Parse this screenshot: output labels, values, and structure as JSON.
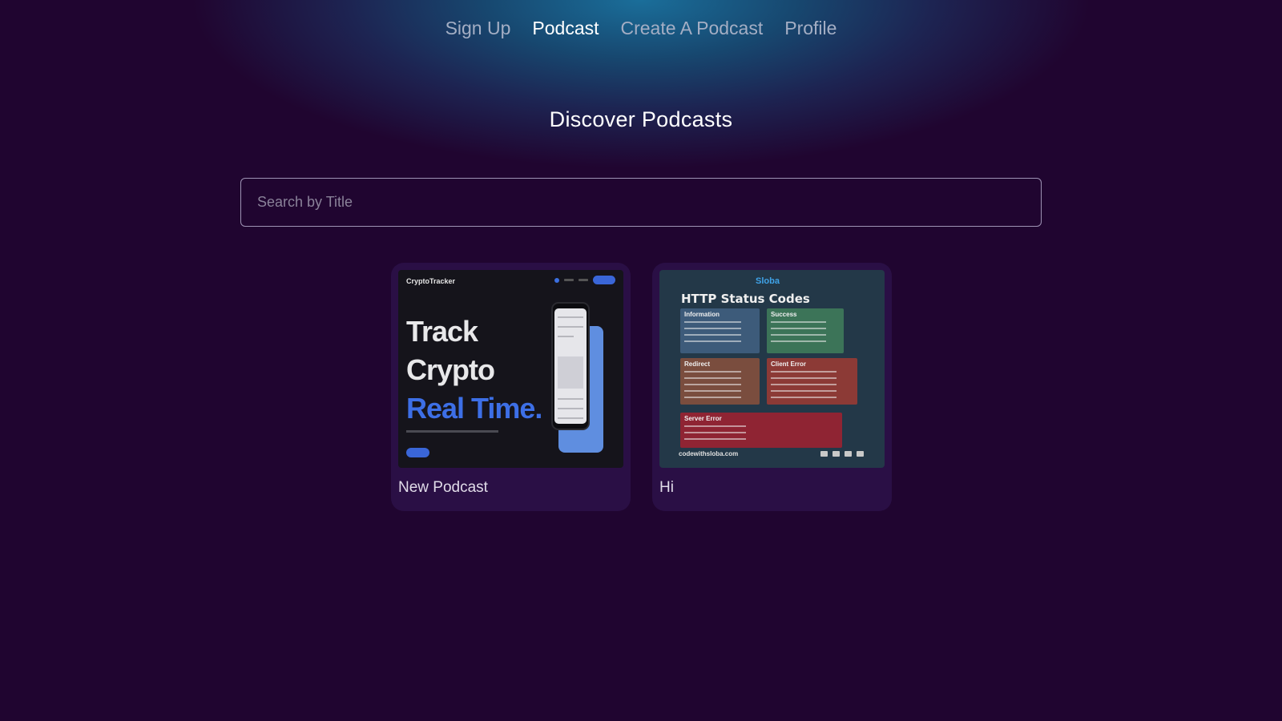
{
  "nav": {
    "items": [
      {
        "label": "Sign Up",
        "active": false
      },
      {
        "label": "Podcast",
        "active": true
      },
      {
        "label": "Create A Podcast",
        "active": false
      },
      {
        "label": "Profile",
        "active": false
      }
    ]
  },
  "page": {
    "title": "Discover Podcasts"
  },
  "search": {
    "placeholder": "Search by Title",
    "value": ""
  },
  "podcasts": [
    {
      "title": "New Podcast",
      "thumbnail": {
        "brand": "CryptoTracker",
        "headline": [
          "Track",
          "Crypto",
          "Real Time."
        ]
      }
    },
    {
      "title": "Hi",
      "thumbnail": {
        "logo": "Sloba",
        "heading": "HTTP Status Codes",
        "sections": [
          "Information",
          "Success",
          "Redirect",
          "Client Error",
          "Server Error"
        ],
        "footer": "codewithsloba.com"
      }
    }
  ],
  "colors": {
    "background": "#200530",
    "card": "#2a0f45",
    "accent_glow": "#1a6e9a",
    "nav_inactive": "#a4aec4",
    "nav_active": "#ffffff"
  }
}
